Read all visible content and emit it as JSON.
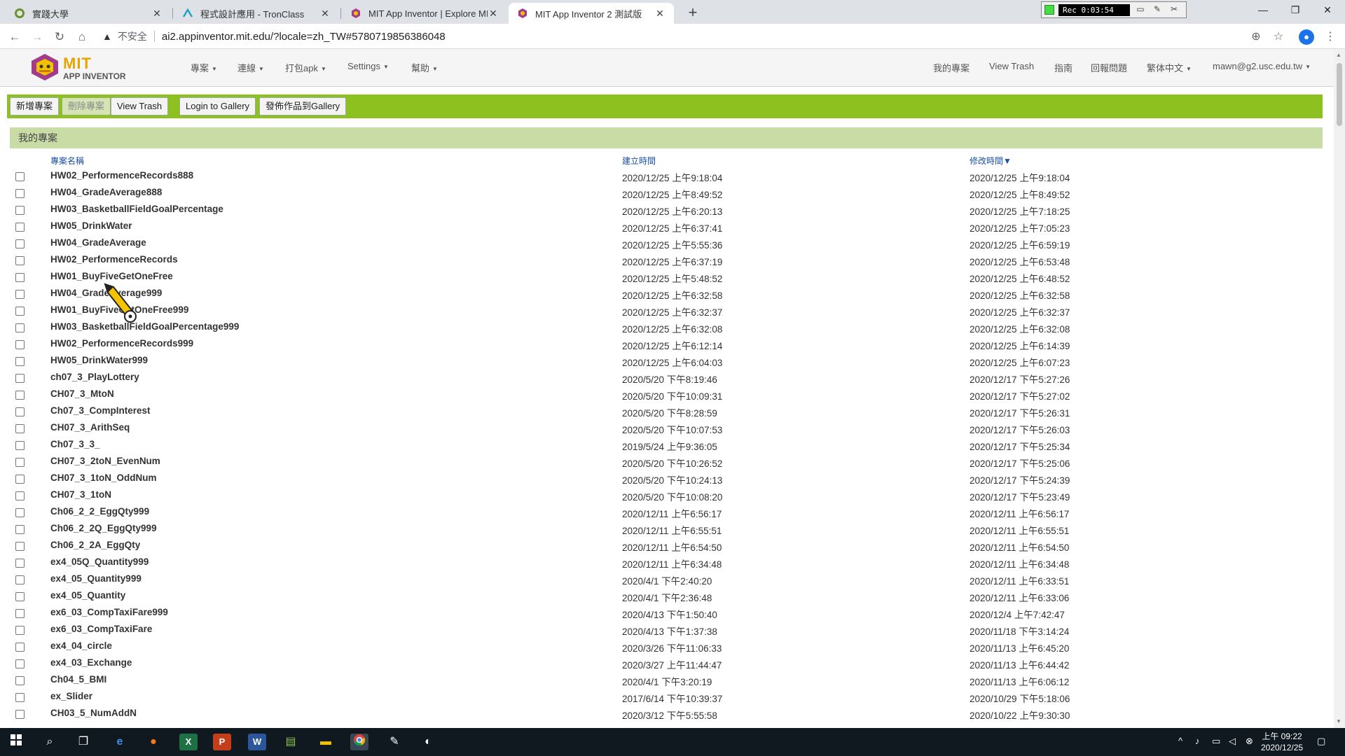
{
  "browser": {
    "tabs": [
      {
        "title": "實踐大學",
        "active": false
      },
      {
        "title": "程式設計應用 - TronClass",
        "active": false
      },
      {
        "title": "MIT App Inventor | Explore MIT",
        "active": false
      },
      {
        "title": "MIT App Inventor 2 測試版",
        "active": true
      }
    ],
    "recorder_time": "Rec 0:03:54",
    "insecure_label": "不安全",
    "url": "ai2.appinventor.mit.edu/?locale=zh_TW#5780719856386048"
  },
  "app": {
    "logo_mit": "MIT",
    "logo_sub": "APP INVENTOR",
    "left_menu": [
      "專案",
      "連線",
      "打包apk",
      "Settings",
      "幫助"
    ],
    "right_menu": [
      "我的專案",
      "View Trash",
      "指南",
      "回報問題",
      "繁体中文",
      "mawn@g2.usc.edu.tw"
    ]
  },
  "toolbar": {
    "new_project": "新增專案",
    "delete_project": "刪除專案",
    "view_trash": "View Trash",
    "login_gallery": "Login to Gallery",
    "publish_gallery": "發佈作品到Gallery"
  },
  "projects": {
    "panel_title": "我的專案",
    "col_name": "專案名稱",
    "col_created": "建立時間",
    "col_modified": "修改時間",
    "sort_indicator": "▼",
    "rows": [
      {
        "name": "HW02_PerformenceRecords888",
        "created": "2020/12/25 上午9:18:04",
        "modified": "2020/12/25 上午9:18:04"
      },
      {
        "name": "HW04_GradeAverage888",
        "created": "2020/12/25 上午8:49:52",
        "modified": "2020/12/25 上午8:49:52"
      },
      {
        "name": "HW03_BasketballFieldGoalPercentage",
        "created": "2020/12/25 上午6:20:13",
        "modified": "2020/12/25 上午7:18:25"
      },
      {
        "name": "HW05_DrinkWater",
        "created": "2020/12/25 上午6:37:41",
        "modified": "2020/12/25 上午7:05:23"
      },
      {
        "name": "HW04_GradeAverage",
        "created": "2020/12/25 上午5:55:36",
        "modified": "2020/12/25 上午6:59:19"
      },
      {
        "name": "HW02_PerformenceRecords",
        "created": "2020/12/25 上午6:37:19",
        "modified": "2020/12/25 上午6:53:48"
      },
      {
        "name": "HW01_BuyFiveGetOneFree",
        "created": "2020/12/25 上午5:48:52",
        "modified": "2020/12/25 上午6:48:52"
      },
      {
        "name": "HW04_GradeAverage999",
        "created": "2020/12/25 上午6:32:58",
        "modified": "2020/12/25 上午6:32:58"
      },
      {
        "name": "HW01_BuyFiveGetOneFree999",
        "created": "2020/12/25 上午6:32:37",
        "modified": "2020/12/25 上午6:32:37"
      },
      {
        "name": "HW03_BasketballFieldGoalPercentage999",
        "created": "2020/12/25 上午6:32:08",
        "modified": "2020/12/25 上午6:32:08"
      },
      {
        "name": "HW02_PerformenceRecords999",
        "created": "2020/12/25 上午6:12:14",
        "modified": "2020/12/25 上午6:14:39"
      },
      {
        "name": "HW05_DrinkWater999",
        "created": "2020/12/25 上午6:04:03",
        "modified": "2020/12/25 上午6:07:23"
      },
      {
        "name": "ch07_3_PlayLottery",
        "created": "2020/5/20 下午8:19:46",
        "modified": "2020/12/17 下午5:27:26"
      },
      {
        "name": "CH07_3_MtoN",
        "created": "2020/5/20 下午10:09:31",
        "modified": "2020/12/17 下午5:27:02"
      },
      {
        "name": "Ch07_3_CompInterest",
        "created": "2020/5/20 下午8:28:59",
        "modified": "2020/12/17 下午5:26:31"
      },
      {
        "name": "CH07_3_ArithSeq",
        "created": "2020/5/20 下午10:07:53",
        "modified": "2020/12/17 下午5:26:03"
      },
      {
        "name": "Ch07_3_3_",
        "created": "2019/5/24 上午9:36:05",
        "modified": "2020/12/17 下午5:25:34"
      },
      {
        "name": "CH07_3_2toN_EvenNum",
        "created": "2020/5/20 下午10:26:52",
        "modified": "2020/12/17 下午5:25:06"
      },
      {
        "name": "CH07_3_1toN_OddNum",
        "created": "2020/5/20 下午10:24:13",
        "modified": "2020/12/17 下午5:24:39"
      },
      {
        "name": "CH07_3_1toN",
        "created": "2020/5/20 下午10:08:20",
        "modified": "2020/12/17 下午5:23:49"
      },
      {
        "name": "Ch06_2_2_EggQty999",
        "created": "2020/12/11 上午6:56:17",
        "modified": "2020/12/11 上午6:56:17"
      },
      {
        "name": "Ch06_2_2Q_EggQty999",
        "created": "2020/12/11 上午6:55:51",
        "modified": "2020/12/11 上午6:55:51"
      },
      {
        "name": "Ch06_2_2A_EggQty",
        "created": "2020/12/11 上午6:54:50",
        "modified": "2020/12/11 上午6:54:50"
      },
      {
        "name": "ex4_05Q_Quantity999",
        "created": "2020/12/11 上午6:34:48",
        "modified": "2020/12/11 上午6:34:48"
      },
      {
        "name": "ex4_05_Quantity999",
        "created": "2020/4/1 下午2:40:20",
        "modified": "2020/12/11 上午6:33:51"
      },
      {
        "name": "ex4_05_Quantity",
        "created": "2020/4/1 下午2:36:48",
        "modified": "2020/12/11 上午6:33:06"
      },
      {
        "name": "ex6_03_CompTaxiFare999",
        "created": "2020/4/13 下午1:50:40",
        "modified": "2020/12/4 上午7:42:47"
      },
      {
        "name": "ex6_03_CompTaxiFare",
        "created": "2020/4/13 下午1:37:38",
        "modified": "2020/11/18 下午3:14:24"
      },
      {
        "name": "ex4_04_circle",
        "created": "2020/3/26 下午11:06:33",
        "modified": "2020/11/13 上午6:45:20"
      },
      {
        "name": "ex4_03_Exchange",
        "created": "2020/3/27 上午11:44:47",
        "modified": "2020/11/13 上午6:44:42"
      },
      {
        "name": "Ch04_5_BMI",
        "created": "2020/4/1 下午3:20:19",
        "modified": "2020/11/13 上午6:06:12"
      },
      {
        "name": "ex_Slider",
        "created": "2017/6/14 下午10:39:37",
        "modified": "2020/10/29 下午5:18:06"
      },
      {
        "name": "CH03_5_NumAddN",
        "created": "2020/3/12 下午5:55:58",
        "modified": "2020/10/22 上午9:30:30"
      }
    ]
  },
  "taskbar": {
    "clock_time": "上午 09:22",
    "clock_date": "2020/12/25"
  },
  "colors": {
    "toolbar_green": "#8cc11f",
    "panel_green": "#c9dca6",
    "link_blue": "#1a4fa6",
    "logo_gold": "#e8a400"
  }
}
